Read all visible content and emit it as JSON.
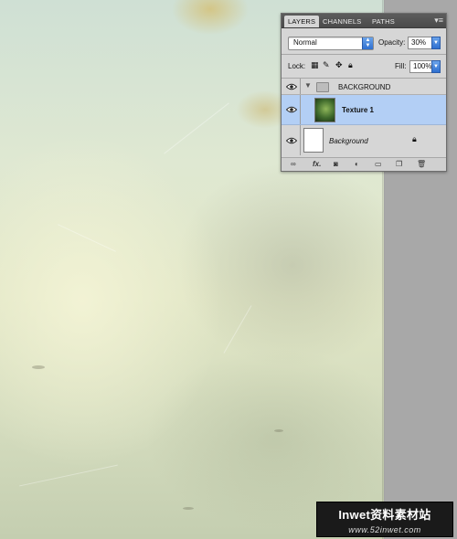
{
  "layers_panel": {
    "tabs": [
      {
        "label": "LAYERS",
        "active": true
      },
      {
        "label": "CHANNELS",
        "active": false
      },
      {
        "label": "PATHS",
        "active": false
      }
    ],
    "blend_mode": "Normal",
    "opacity_label": "Opacity:",
    "opacity_value": "30%",
    "lock_label": "Lock:",
    "fill_label": "Fill:",
    "fill_value": "100%",
    "layers": [
      {
        "name": "BACKGROUND",
        "type": "group",
        "visible": true
      },
      {
        "name": "Texture 1",
        "type": "image",
        "visible": true,
        "selected": true
      },
      {
        "name": "Background",
        "type": "background",
        "visible": true,
        "locked": true
      }
    ],
    "footer_icons": [
      "link-icon",
      "fx-icon",
      "mask-icon",
      "adjustment-icon",
      "folder-icon",
      "new-layer-icon",
      "trash-icon"
    ]
  },
  "watermark": {
    "line1": "Inwet资料素材站",
    "line2": "www.52inwet.com"
  },
  "colors": {
    "selection": "#b3cff5",
    "accent": "#2e6fd0"
  }
}
